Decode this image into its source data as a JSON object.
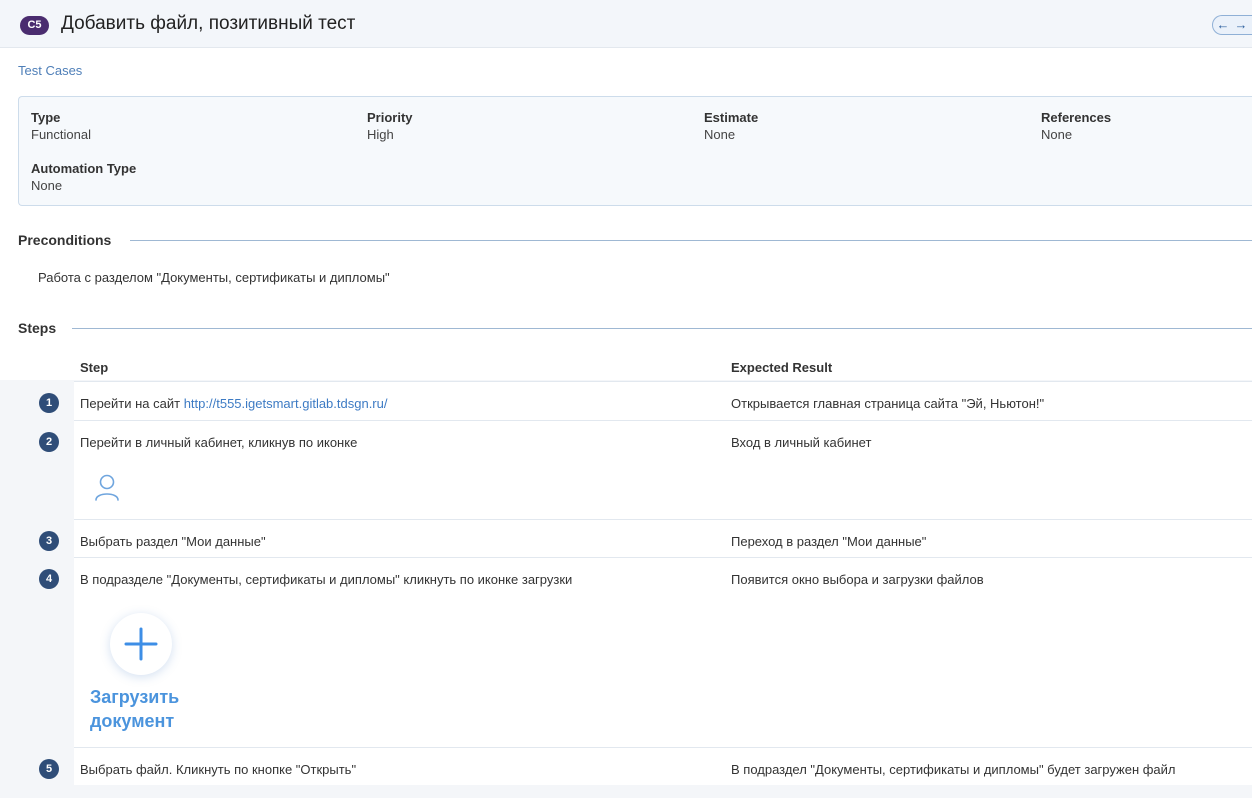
{
  "header": {
    "case_id": "C5",
    "title": "Добавить файл, позитивный тест",
    "nav_prev": "←",
    "nav_next": "→"
  },
  "breadcrumb": "Test Cases",
  "fields": {
    "type_label": "Type",
    "type_value": "Functional",
    "priority_label": "Priority",
    "priority_value": "High",
    "estimate_label": "Estimate",
    "estimate_value": "None",
    "references_label": "References",
    "references_value": "None",
    "automation_label": "Automation Type",
    "automation_value": "None"
  },
  "preconditions": {
    "title": "Preconditions",
    "text": "Работа с разделом \"Документы, сертификаты и дипломы\""
  },
  "steps": {
    "title": "Steps",
    "col_step": "Step",
    "col_expected": "Expected Result",
    "items": [
      {
        "num": "1",
        "text": "Перейти на сайт ",
        "link": "http://t555.igetsmart.gitlab.tdsgn.ru/",
        "expected": "Открывается главная страница сайта \"Эй, Ньютон!\""
      },
      {
        "num": "2",
        "text": "Перейти в личный кабинет, кликнув по иконке",
        "expected": "Вход в личный кабинет"
      },
      {
        "num": "3",
        "text": "Выбрать раздел \"Мои данные\"",
        "expected": "Переход в раздел \"Мои данные\""
      },
      {
        "num": "4",
        "text": "В подразделе \"Документы, сертификаты и дипломы\" кликнуть по иконке загрузки",
        "expected": "Появится окно выбора и загрузки файлов",
        "upload_label_1": "Загрузить",
        "upload_label_2": "документ"
      },
      {
        "num": "5",
        "text": "Выбрать файл. Кликнуть по кнопке \"Открыть\"",
        "expected": "В подраздел \"Документы, сертификаты и дипломы\" будет загружен файл"
      }
    ]
  },
  "colors": {
    "case_badge": "#4a2c6f",
    "step_badge": "#2f4d78",
    "link": "#3d7bc4",
    "upload_accent": "#3d8ee6"
  },
  "icons": {
    "user": "user-outline-icon",
    "upload": "plus-icon"
  }
}
